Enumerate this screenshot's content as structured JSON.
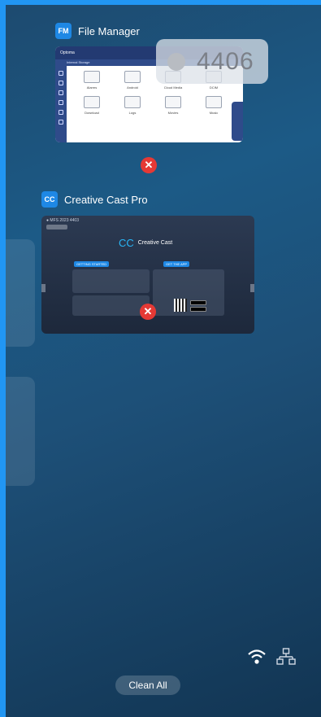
{
  "apps": [
    {
      "icon_text": "FM",
      "title": "File Manager"
    },
    {
      "icon_text": "CC",
      "title": "Creative Cast Pro"
    }
  ],
  "file_manager_preview": {
    "brand": "Optoma",
    "breadcrumb": "Internal Storage",
    "folders": [
      "Alarms",
      "Android",
      "Cloud Media",
      "DCIM",
      "Download",
      "Logs",
      "Movies",
      "Music"
    ]
  },
  "overlay": {
    "number": "4406"
  },
  "creative_cast_preview": {
    "status": "● MFS 2023 4403",
    "brand": "Creative Cast",
    "getting_started": "GETTING STARTED",
    "get_the_app": "GET THE APP"
  },
  "footer": {
    "clean_all_label": "Clean All"
  },
  "icons": {
    "close": "close-x-icon",
    "wifi": "wifi-icon",
    "network": "network-icon"
  },
  "colors": {
    "accent": "#2196f3",
    "close": "#e53935",
    "background": "#1c5a86"
  }
}
